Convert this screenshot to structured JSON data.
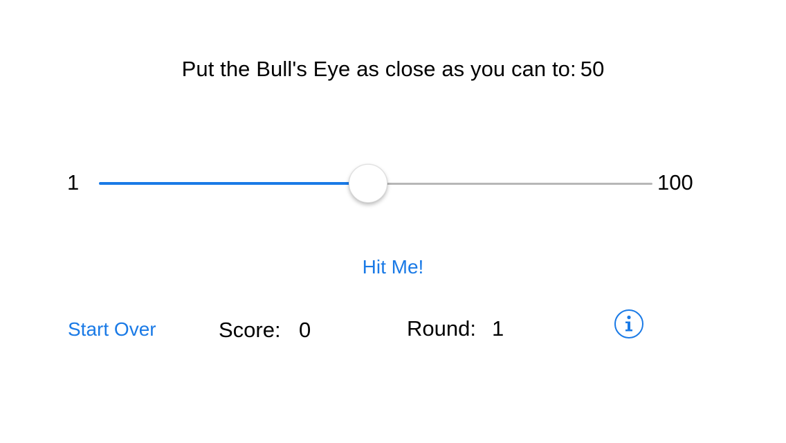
{
  "target": {
    "prompt": "Put the Bull's Eye as close as you can to:",
    "value": "50"
  },
  "slider": {
    "min_label": "1",
    "max_label": "100",
    "min": 1,
    "max": 100,
    "value": 50,
    "min_track_color": "#1a7ae6",
    "max_track_color": "#b7b7b7"
  },
  "actions": {
    "hit_me_label": "Hit Me!",
    "start_over_label": "Start Over",
    "info_icon": "info-icon"
  },
  "stats": {
    "score_label": "Score:",
    "score_value": "0",
    "round_label": "Round:",
    "round_value": "1"
  },
  "colors": {
    "accent": "#1a7ae6",
    "text": "#000000",
    "background": "#ffffff"
  }
}
